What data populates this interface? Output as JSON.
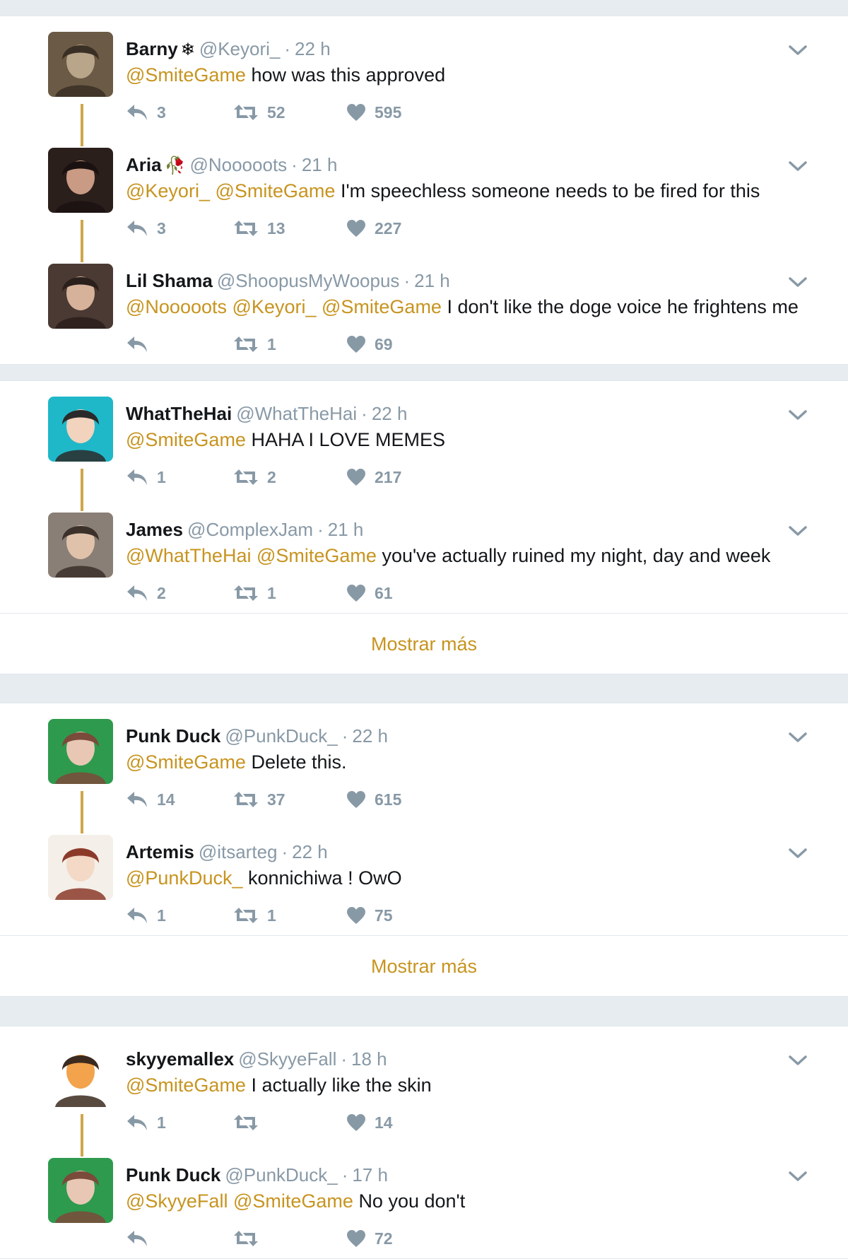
{
  "threads": [
    {
      "tweets": [
        {
          "name": "Barny",
          "badge": "❄",
          "handle": "@Keyori_",
          "time": "22 h",
          "mentions": [
            "@SmiteGame"
          ],
          "text": "how was this approved",
          "replies": "3",
          "retweets": "52",
          "likes": "595"
        },
        {
          "name": "Aria",
          "badge": "🥀",
          "handle": "@Nooooots",
          "time": "21 h",
          "mentions": [
            "@Keyori_",
            "@SmiteGame"
          ],
          "text": "I'm speechless someone needs to be fired for this",
          "replies": "3",
          "retweets": "13",
          "likes": "227"
        },
        {
          "name": "Lil Shama",
          "badge": "",
          "handle": "@ShoopusMyWoopus",
          "time": "21 h",
          "mentions": [
            "@Nooooots",
            "@Keyori_",
            "@SmiteGame"
          ],
          "text": "I don't like the doge voice he frightens me",
          "replies": "",
          "retweets": "1",
          "likes": "69"
        }
      ],
      "show_more": ""
    },
    {
      "tweets": [
        {
          "name": "WhatTheHai",
          "badge": "",
          "handle": "@WhatTheHai",
          "time": "22 h",
          "mentions": [
            "@SmiteGame"
          ],
          "text": "HAHA I LOVE MEMES",
          "replies": "1",
          "retweets": "2",
          "likes": "217"
        },
        {
          "name": "James",
          "badge": "",
          "handle": "@ComplexJam",
          "time": "21 h",
          "mentions": [
            "@WhatTheHai",
            "@SmiteGame"
          ],
          "text": "you've actually ruined my night, day and week",
          "replies": "2",
          "retweets": "1",
          "likes": "61"
        }
      ],
      "show_more": "Mostrar más"
    },
    {
      "tweets": [
        {
          "name": "Punk Duck",
          "badge": "",
          "handle": "@PunkDuck_",
          "time": "22 h",
          "mentions": [
            "@SmiteGame"
          ],
          "text": "Delete this.",
          "replies": "14",
          "retweets": "37",
          "likes": "615"
        },
        {
          "name": "Artemis",
          "badge": "",
          "handle": "@itsarteg",
          "time": "22 h",
          "mentions": [
            "@PunkDuck_"
          ],
          "text": "konnichiwa ! OwO",
          "replies": "1",
          "retweets": "1",
          "likes": "75"
        }
      ],
      "show_more": "Mostrar más"
    },
    {
      "tweets": [
        {
          "name": "skyyemallex",
          "badge": "",
          "handle": "@SkyyeFall",
          "time": "18 h",
          "mentions": [
            "@SmiteGame"
          ],
          "text": "I actually like the skin",
          "replies": "1",
          "retweets": "",
          "likes": "14"
        },
        {
          "name": "Punk Duck",
          "badge": "",
          "handle": "@PunkDuck_",
          "time": "17 h",
          "mentions": [
            "@SkyyeFall",
            "@SmiteGame"
          ],
          "text": "No you don't",
          "replies": "",
          "retweets": "",
          "likes": "72"
        }
      ],
      "show_more": ""
    }
  ],
  "colors": {
    "accent": "#c7941f",
    "muted": "#8899a6",
    "text": "#14171a",
    "background": "#e6ecf0"
  },
  "icons": {
    "reply": "reply-icon",
    "retweet": "retweet-icon",
    "like": "heart-icon",
    "menu": "chevron-down-icon"
  }
}
